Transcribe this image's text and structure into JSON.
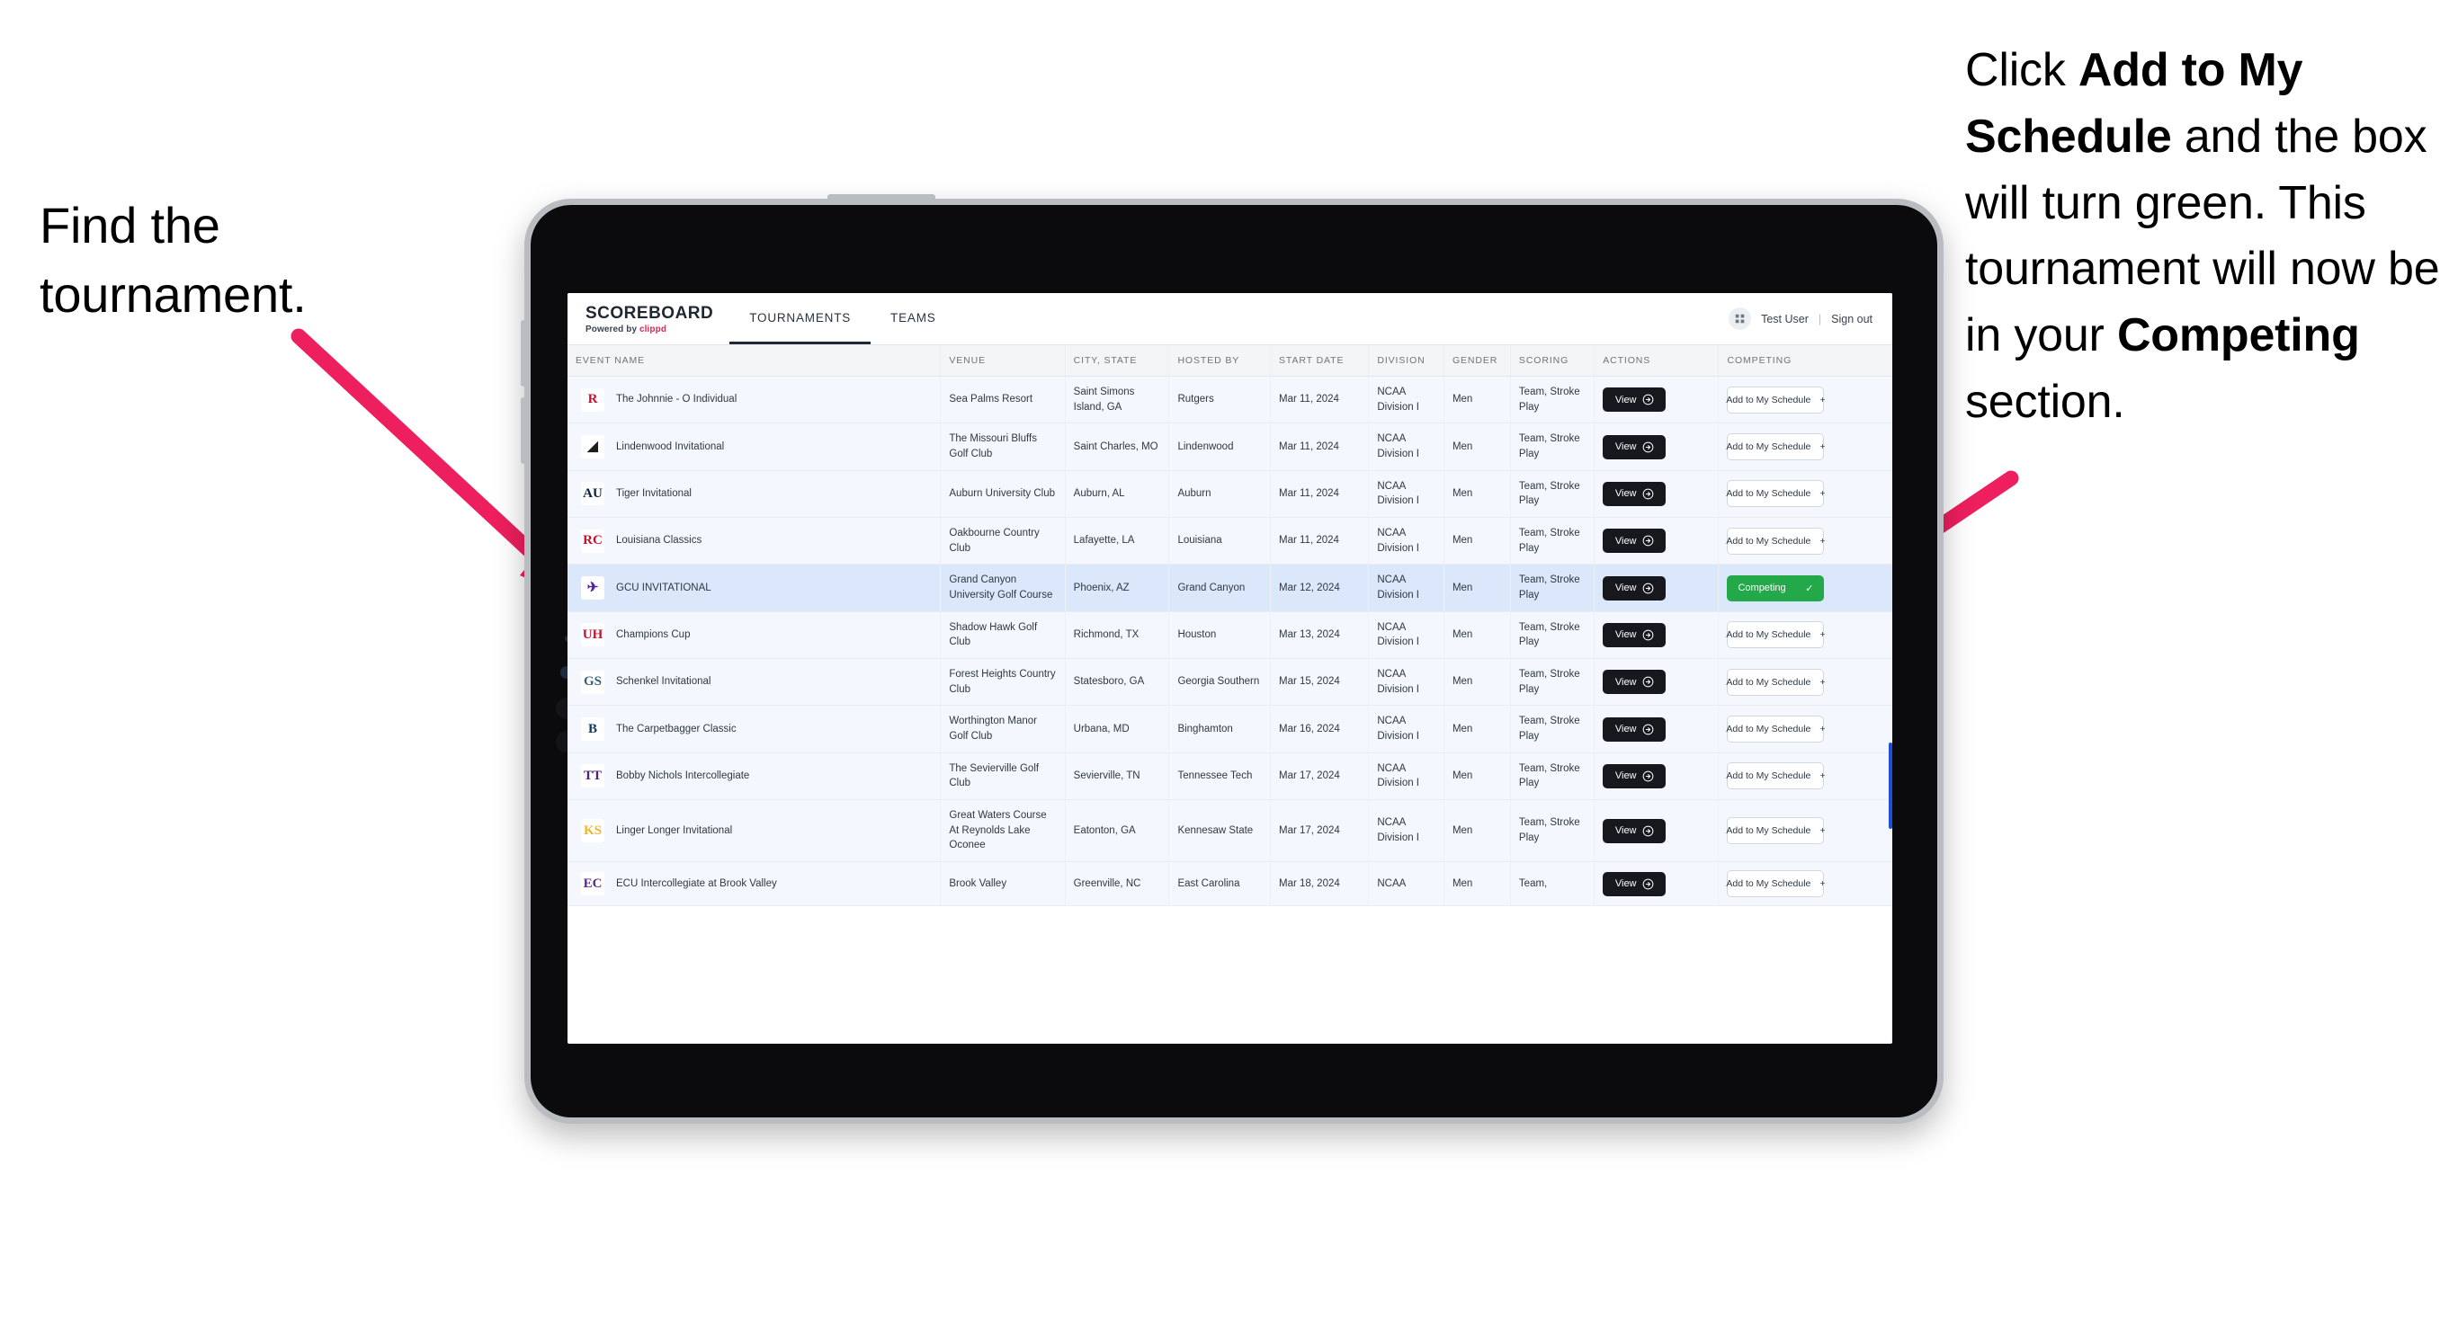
{
  "annotations": {
    "left": "Find the tournament.",
    "right_parts": [
      {
        "text": "Click ",
        "bold": false
      },
      {
        "text": "Add to My Schedule",
        "bold": true
      },
      {
        "text": " and the box will turn green. This tournament will now be in your ",
        "bold": false
      },
      {
        "text": "Competing",
        "bold": true
      },
      {
        "text": " section.",
        "bold": false
      }
    ],
    "arrow_color": "#ed1f5e"
  },
  "app": {
    "brand": {
      "title": "SCOREBOARD",
      "powered_prefix": "Powered by ",
      "powered_brand": "clippd"
    },
    "nav_tabs": [
      {
        "label": "TOURNAMENTS",
        "active": true
      },
      {
        "label": "TEAMS",
        "active": false
      }
    ],
    "user": {
      "avatar_icon": "grid-icon",
      "name": "Test User",
      "divider": "|",
      "sign_out": "Sign out"
    },
    "table": {
      "headers": [
        "EVENT NAME",
        "VENUE",
        "CITY, STATE",
        "HOSTED BY",
        "START DATE",
        "DIVISION",
        "GENDER",
        "SCORING",
        "ACTIONS",
        "COMPETING"
      ],
      "view_label": "View",
      "add_label": "Add to My Schedule",
      "add_plus": "+",
      "competing_label": "Competing",
      "competing_check": "✓",
      "rows": [
        {
          "logo_text": "R",
          "logo_bg": "#ffffff",
          "logo_color": "#c8102e",
          "event": "The Johnnie - O Individual",
          "venue": "Sea Palms Resort",
          "city": "Saint Simons Island, GA",
          "host": "Rutgers",
          "date": "Mar 11, 2024",
          "division": "NCAA Division I",
          "gender": "Men",
          "scoring": "Team, Stroke Play",
          "competing": false,
          "highlight": false
        },
        {
          "logo_text": "◢",
          "logo_bg": "#ffffff",
          "logo_color": "#1c1c1c",
          "event": "Lindenwood Invitational",
          "venue": "The Missouri Bluffs Golf Club",
          "city": "Saint Charles, MO",
          "host": "Lindenwood",
          "date": "Mar 11, 2024",
          "division": "NCAA Division I",
          "gender": "Men",
          "scoring": "Team, Stroke Play",
          "competing": false,
          "highlight": false
        },
        {
          "logo_text": "AU",
          "logo_bg": "#ffffff",
          "logo_color": "#0c2340",
          "event": "Tiger Invitational",
          "venue": "Auburn University Club",
          "city": "Auburn, AL",
          "host": "Auburn",
          "date": "Mar 11, 2024",
          "division": "NCAA Division I",
          "gender": "Men",
          "scoring": "Team, Stroke Play",
          "competing": false,
          "highlight": false
        },
        {
          "logo_text": "RC",
          "logo_bg": "#ffffff",
          "logo_color": "#c8102e",
          "event": "Louisiana Classics",
          "venue": "Oakbourne Country Club",
          "city": "Lafayette, LA",
          "host": "Louisiana",
          "date": "Mar 11, 2024",
          "division": "NCAA Division I",
          "gender": "Men",
          "scoring": "Team, Stroke Play",
          "competing": false,
          "highlight": false
        },
        {
          "logo_text": "✈",
          "logo_bg": "#ffffff",
          "logo_color": "#522398",
          "event": "GCU INVITATIONAL",
          "venue": "Grand Canyon University Golf Course",
          "city": "Phoenix, AZ",
          "host": "Grand Canyon",
          "date": "Mar 12, 2024",
          "division": "NCAA Division I",
          "gender": "Men",
          "scoring": "Team, Stroke Play",
          "competing": true,
          "highlight": true
        },
        {
          "logo_text": "UH",
          "logo_bg": "#ffffff",
          "logo_color": "#c8102e",
          "event": "Champions Cup",
          "venue": "Shadow Hawk Golf Club",
          "city": "Richmond, TX",
          "host": "Houston",
          "date": "Mar 13, 2024",
          "division": "NCAA Division I",
          "gender": "Men",
          "scoring": "Team, Stroke Play",
          "competing": false,
          "highlight": false
        },
        {
          "logo_text": "GS",
          "logo_bg": "#ffffff",
          "logo_color": "#36607a",
          "event": "Schenkel Invitational",
          "venue": "Forest Heights Country Club",
          "city": "Statesboro, GA",
          "host": "Georgia Southern",
          "date": "Mar 15, 2024",
          "division": "NCAA Division I",
          "gender": "Men",
          "scoring": "Team, Stroke Play",
          "competing": false,
          "highlight": false
        },
        {
          "logo_text": "B",
          "logo_bg": "#ffffff",
          "logo_color": "#0f3b5f",
          "event": "The Carpetbagger Classic",
          "venue": "Worthington Manor Golf Club",
          "city": "Urbana, MD",
          "host": "Binghamton",
          "date": "Mar 16, 2024",
          "division": "NCAA Division I",
          "gender": "Men",
          "scoring": "Team, Stroke Play",
          "competing": false,
          "highlight": false
        },
        {
          "logo_text": "TT",
          "logo_bg": "#ffffff",
          "logo_color": "#4f2170",
          "event": "Bobby Nichols Intercollegiate",
          "venue": "The Sevierville Golf Club",
          "city": "Sevierville, TN",
          "host": "Tennessee Tech",
          "date": "Mar 17, 2024",
          "division": "NCAA Division I",
          "gender": "Men",
          "scoring": "Team, Stroke Play",
          "competing": false,
          "highlight": false
        },
        {
          "logo_text": "KS",
          "logo_bg": "#ffffff",
          "logo_color": "#ecb731",
          "event": "Linger Longer Invitational",
          "venue": "Great Waters Course At Reynolds Lake Oconee",
          "city": "Eatonton, GA",
          "host": "Kennesaw State",
          "date": "Mar 17, 2024",
          "division": "NCAA Division I",
          "gender": "Men",
          "scoring": "Team, Stroke Play",
          "competing": false,
          "highlight": false
        },
        {
          "logo_text": "EC",
          "logo_bg": "#ffffff",
          "logo_color": "#592a8a",
          "event": "ECU Intercollegiate at Brook Valley",
          "venue": "Brook Valley",
          "city": "Greenville, NC",
          "host": "East Carolina",
          "date": "Mar 18, 2024",
          "division": "NCAA",
          "gender": "Men",
          "scoring": "Team,",
          "competing": false,
          "highlight": false
        }
      ]
    }
  }
}
